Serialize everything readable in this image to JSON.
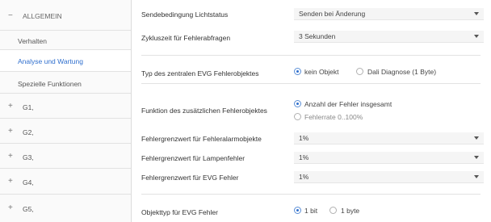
{
  "sidebar": {
    "groups": [
      {
        "toggle": "−",
        "label": "ALLGEMEIN"
      },
      {
        "toggle": "+",
        "label": "G1,"
      },
      {
        "toggle": "+",
        "label": "G2,"
      },
      {
        "toggle": "+",
        "label": "G3,"
      },
      {
        "toggle": "+",
        "label": "G4,"
      },
      {
        "toggle": "+",
        "label": "G5,"
      }
    ],
    "items": [
      {
        "label": "Verhalten"
      },
      {
        "label": "Analyse und Wartung"
      },
      {
        "label": "Spezielle Funktionen"
      }
    ],
    "active_color": "#2f6fce"
  },
  "main": {
    "send_condition": {
      "label": "Sendebedingung Lichtstatus",
      "value": "Senden bei Änderung"
    },
    "cycle_time": {
      "label": "Zykluszeit für Fehlerabfragen",
      "value": "3 Sekunden"
    },
    "error_type": {
      "label": "Typ des zentralen EVG Fehlerobjektes",
      "options": [
        "kein Objekt",
        "Dali Diagnose (1 Byte)"
      ],
      "selected": 0
    },
    "extra_function": {
      "label": "Funktion des zusätzlichen Fehlerobjektes",
      "options": [
        "Anzahl der Fehler insgesamt",
        "Fehlerrate 0..100%"
      ],
      "selected": 0
    },
    "threshold_alarm": {
      "label": "Fehlergrenzwert für Fehleralarmobjekte",
      "value": "1%"
    },
    "threshold_lamp": {
      "label": "Fehlergrenzwert für Lampenfehler",
      "value": "1%"
    },
    "threshold_evg": {
      "label": "Fehlergrenzwert für EVG Fehler",
      "value": "1%"
    },
    "object_type": {
      "label": "Objekttyp für EVG Fehler",
      "options": [
        "1 bit",
        "1 byte"
      ],
      "selected": 0
    }
  }
}
